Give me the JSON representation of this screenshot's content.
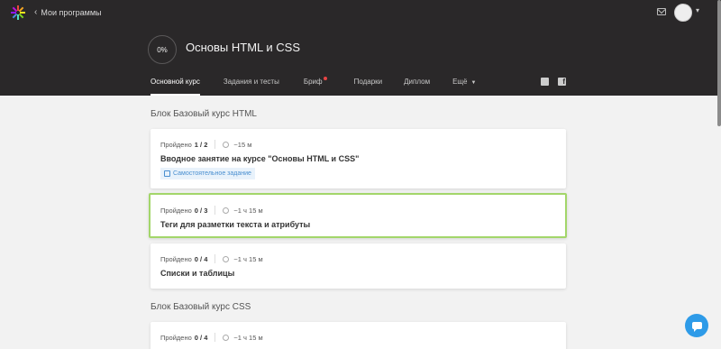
{
  "header": {
    "back_label": "Мои программы",
    "progress": "0%",
    "course_title": "Основы HTML и CSS",
    "tabs": [
      {
        "label": "Основной курс"
      },
      {
        "label": "Задания и тесты"
      },
      {
        "label": "Бриф"
      },
      {
        "label": "Подарки"
      },
      {
        "label": "Диплом"
      },
      {
        "label": "Ещё"
      }
    ]
  },
  "blocks": [
    {
      "title": "Блок Базовый курс HTML",
      "cards": [
        {
          "passed_label": "Пройдено",
          "passed": "1 / 2",
          "duration": "~15 м",
          "title": "Вводное занятие на курсе \"Основы HTML и CSS\"",
          "badge": "Самостоятельное задание"
        },
        {
          "passed_label": "Пройдено",
          "passed": "0 / 3",
          "duration": "~1 ч 15 м",
          "title": "Теги для разметки текста и атрибуты"
        },
        {
          "passed_label": "Пройдено",
          "passed": "0 / 4",
          "duration": "~1 ч 15 м",
          "title": "Списки и таблицы"
        }
      ]
    },
    {
      "title": "Блок Базовый курс CSS",
      "cards": [
        {
          "passed_label": "Пройдено",
          "passed": "0 / 4",
          "duration": "~1 ч 15 м"
        }
      ]
    }
  ],
  "colors": {
    "header_bg": "#2a2829",
    "highlight": "#a3d66a",
    "chat": "#2e9be8",
    "notify_dot": "#e84545"
  }
}
